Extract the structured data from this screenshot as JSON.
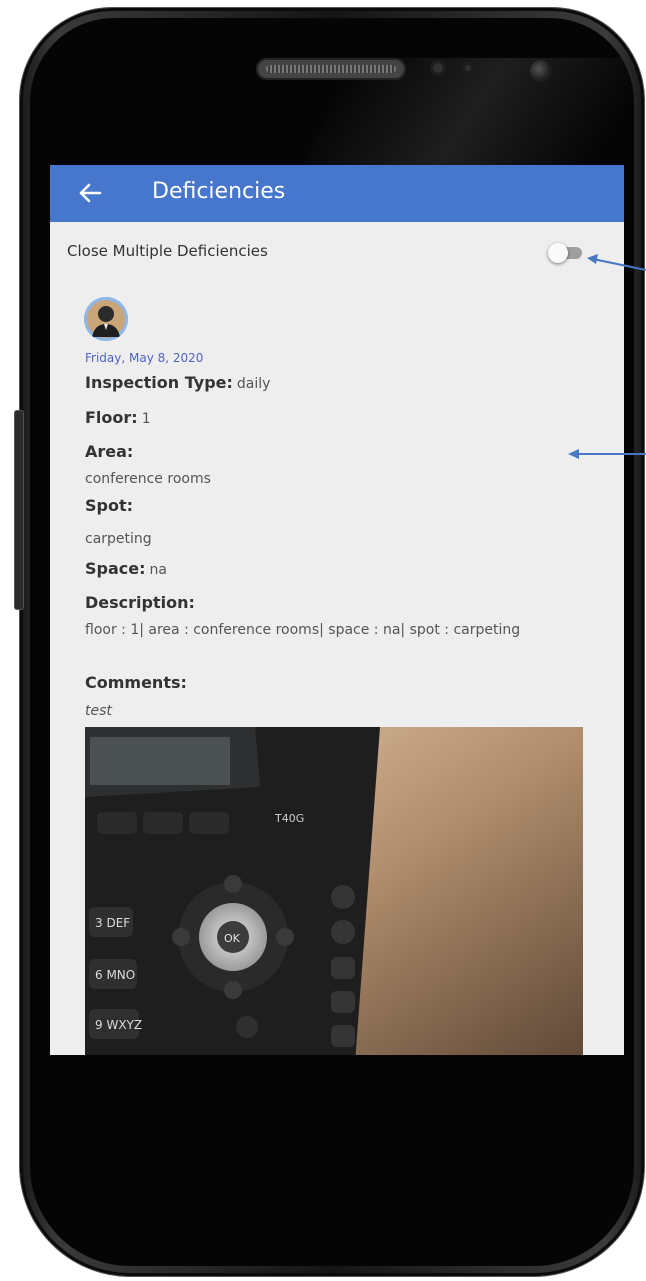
{
  "appbar": {
    "title": "Deficiencies",
    "back_icon": "arrow-left-icon",
    "color": "#4677cc"
  },
  "toggle": {
    "label": "Close Multiple Deficiencies",
    "on": false
  },
  "deficiency": {
    "date": "Friday, May 8, 2020",
    "inspection_type_label": "Inspection Type:",
    "inspection_type": "daily",
    "floor_label": "Floor:",
    "floor": "1",
    "area_label": "Area:",
    "area": "conference rooms",
    "spot_label": "Spot:",
    "spot": "carpeting",
    "space_label": "Space:",
    "space": "na",
    "description_label": "Description:",
    "description": "floor : 1| area : conference rooms| space : na| spot : carpeting",
    "comments_label": "Comments:",
    "comments": "test"
  },
  "photo": {
    "phone_model": "T40G",
    "ok_key": "OK",
    "keys": [
      "3 DEF",
      "6 MNO",
      "9 WXYZ"
    ]
  },
  "navbar": {
    "items": [
      "game-launcher-icon",
      "recents-icon",
      "home-icon",
      "back-icon",
      "screenshot-icon"
    ]
  }
}
